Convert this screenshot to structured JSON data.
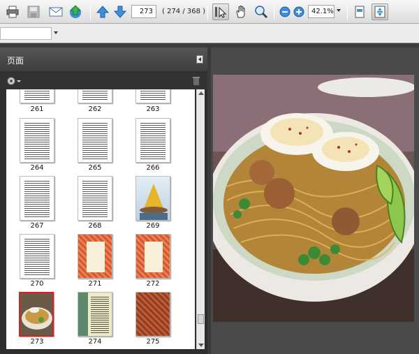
{
  "toolbar": {
    "current_page": "273",
    "page_count": "( 274 / 368 )",
    "zoom": "42.1%",
    "icons": [
      "print-icon",
      "save-icon",
      "email-icon",
      "upload-icon",
      "prev-page-icon",
      "next-page-icon",
      "select-tool-icon",
      "hand-tool-icon",
      "zoom-tool-icon",
      "zoom-out-icon",
      "zoom-in-icon",
      "fit-width-icon",
      "fit-page-icon"
    ]
  },
  "panel": {
    "title": "页面",
    "options_icon": "gear-icon",
    "delete_icon": "trash-icon"
  },
  "thumbnails": [
    {
      "label": "261",
      "kind": "text"
    },
    {
      "label": "262",
      "kind": "text"
    },
    {
      "label": "263",
      "kind": "text"
    },
    {
      "label": "264",
      "kind": "text"
    },
    {
      "label": "265",
      "kind": "text"
    },
    {
      "label": "266",
      "kind": "text"
    },
    {
      "label": "267",
      "kind": "text"
    },
    {
      "label": "268",
      "kind": "text"
    },
    {
      "label": "269",
      "kind": "food-photo"
    },
    {
      "label": "270",
      "kind": "text"
    },
    {
      "label": "271",
      "kind": "patterned"
    },
    {
      "label": "272",
      "kind": "patterned"
    },
    {
      "label": "273",
      "kind": "food-photo",
      "selected": true
    },
    {
      "label": "274",
      "kind": "recipe"
    },
    {
      "label": "275",
      "kind": "patterned-dark"
    }
  ],
  "colors": {
    "panel_bg": "#2e2e2e",
    "selection": "#d62020",
    "pattern": "#d9572b"
  }
}
